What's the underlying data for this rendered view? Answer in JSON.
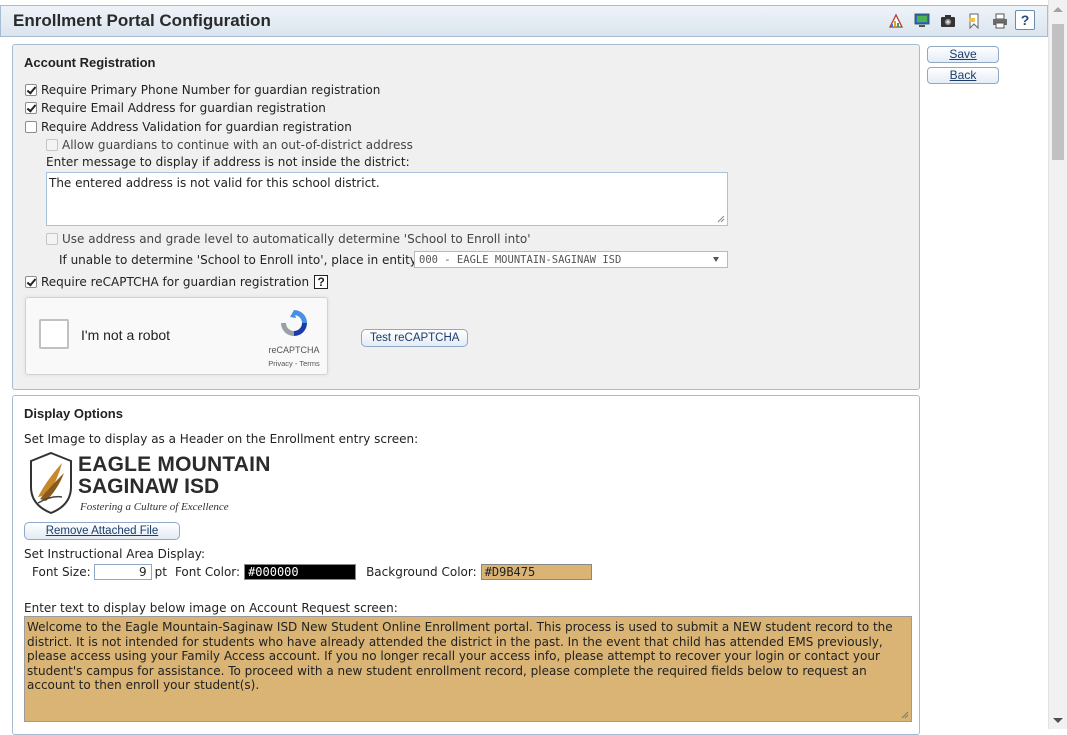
{
  "window": {
    "title": "Enrollment Portal Configuration",
    "help_label": "?"
  },
  "toolbar": {
    "icons": [
      "report-icon",
      "monitor-icon",
      "camera-icon",
      "bookmark-icon",
      "print-icon",
      "help-icon"
    ]
  },
  "sidebar": {
    "save_label": "Save",
    "back_label": "Back"
  },
  "account_registration": {
    "heading": "Account Registration",
    "require_phone": {
      "label": "Require Primary Phone Number for guardian registration",
      "checked": true
    },
    "require_email": {
      "label": "Require Email Address for guardian registration",
      "checked": true
    },
    "require_address": {
      "label": "Require Address Validation for guardian registration",
      "checked": false
    },
    "allow_out_of_district": {
      "label": "Allow guardians to continue with an out-of-district address",
      "checked": false
    },
    "message_prompt": "Enter message to display if address is not inside the district:",
    "message_value": "The entered address is not valid for this school district.",
    "use_address_grade": {
      "label": "Use address and grade level to automatically determine 'School to Enroll into'",
      "checked": false
    },
    "unable_prompt": "If unable to determine 'School to Enroll into', place in entity:",
    "entity_selected": "000 - EAGLE MOUNTAIN-SAGINAW ISD",
    "require_recaptcha": {
      "label": "Require reCAPTCHA for guardian registration",
      "checked": true
    },
    "recaptcha_help": "?",
    "recaptcha_widget": {
      "checkbox_label": "I'm not a robot",
      "brand": "reCAPTCHA",
      "terms": "Privacy - Terms"
    },
    "test_recaptcha_label": "Test reCAPTCHA"
  },
  "display_options": {
    "heading": "Display Options",
    "header_image_prompt": "Set Image to display as a Header on the Enrollment entry screen:",
    "logo": {
      "line1": "EAGLE MOUNTAIN",
      "line2": "SAGINAW ISD",
      "tagline": "Fostering a Culture of Excellence"
    },
    "remove_file_label": "Remove Attached File",
    "instructional_prompt": "Set Instructional Area Display:",
    "font_size_label": "Font Size:",
    "font_size_value": "9",
    "font_size_unit": "pt",
    "font_color_label": "Font Color:",
    "font_color_value": "#000000",
    "background_color_label": "Background Color:",
    "background_color_value": "#D9B475",
    "text_prompt": "Enter text to display below image on Account Request screen:",
    "text_value": "Welcome to the Eagle Mountain-Saginaw ISD New Student Online Enrollment portal. This process is used to submit a NEW student record to the district. It is not intended for students who have already attended the district in the past. In the event that child has attended EMS previously, please access using your Family Access account. If you no longer recall your access info, please attempt to recover your login or contact your student's campus for assistance. To proceed with a new student enrollment record, please complete the required fields below to request an account to then enroll your student(s)."
  },
  "colors": {
    "accent": "#1a3d6b",
    "panel_border": "#a8bccf",
    "instruction_bg": "#D9B475"
  }
}
